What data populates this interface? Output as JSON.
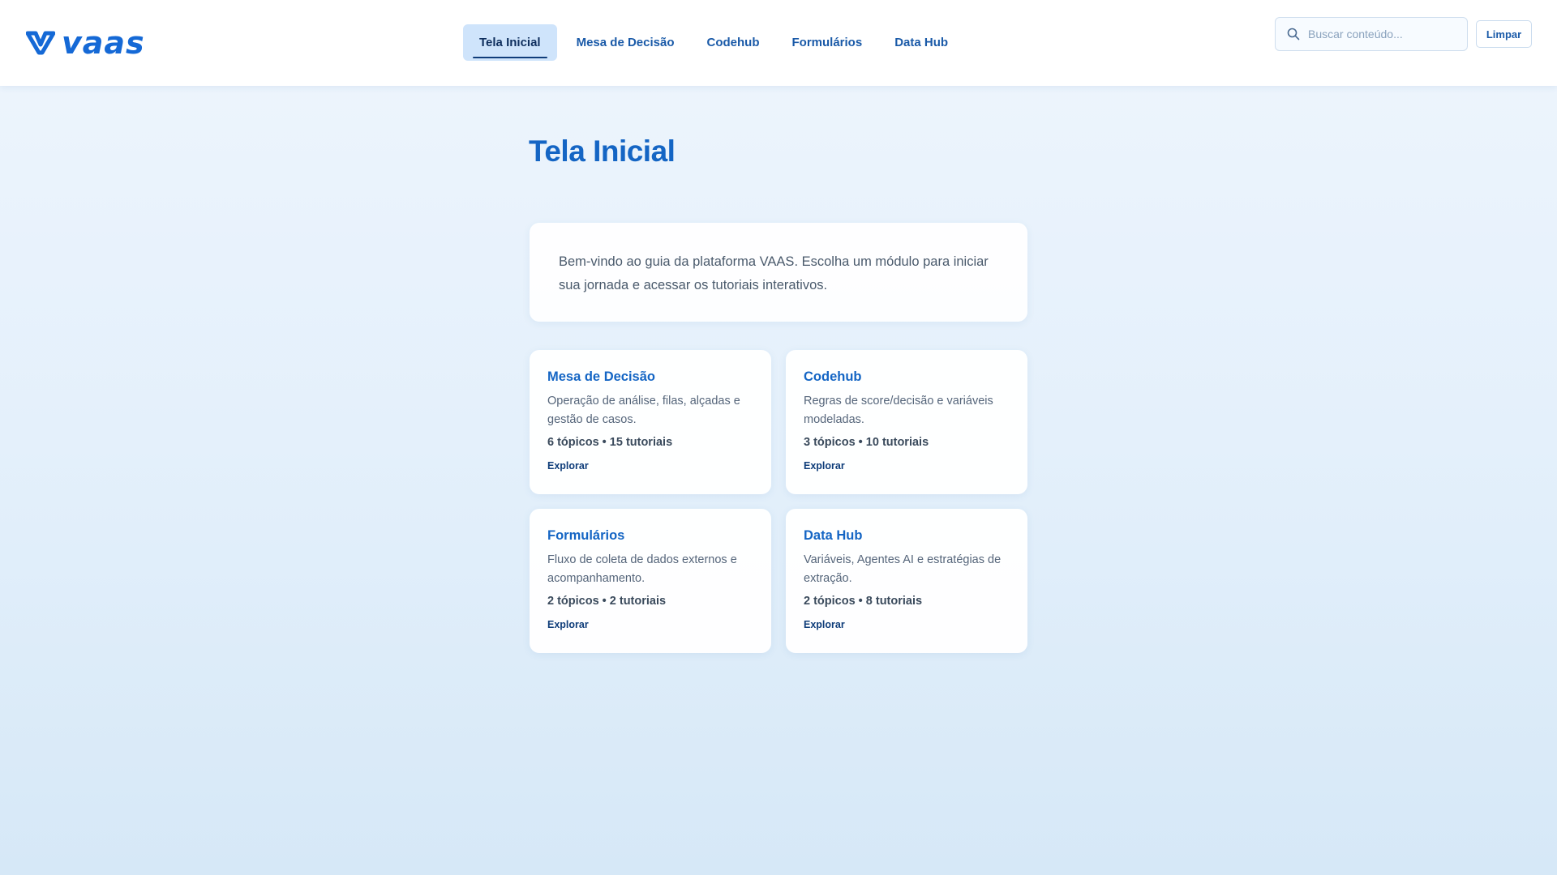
{
  "brand": {
    "name": "VAAS",
    "logo_text": "vaas",
    "accent": "#1569d6"
  },
  "nav": {
    "items": [
      {
        "label": "Tela Inicial",
        "active": true
      },
      {
        "label": "Mesa de Decisão",
        "active": false
      },
      {
        "label": "Codehub",
        "active": false
      },
      {
        "label": "Formulários",
        "active": false
      },
      {
        "label": "Data Hub",
        "active": false
      }
    ]
  },
  "search": {
    "placeholder": "Buscar conteúdo...",
    "value": "",
    "icon": "search-icon"
  },
  "clear_label": "Limpar",
  "page": {
    "title": "Tela Inicial",
    "intro": "Bem-vindo ao guia da plataforma VAAS. Escolha um módulo para iniciar sua jornada e acessar os tutoriais interativos."
  },
  "modules": [
    {
      "title": "Mesa de Decisão",
      "description": "Operação de análise, filas, alçadas e gestão de casos.",
      "stats": "6 tópicos • 15 tutoriais",
      "link": "Explorar"
    },
    {
      "title": "Codehub",
      "description": "Regras de score/decisão e variáveis modeladas.",
      "stats": "3 tópicos • 10 tutoriais",
      "link": "Explorar"
    },
    {
      "title": "Formulários",
      "description": "Fluxo de coleta de dados externos e acompanhamento.",
      "stats": "2 tópicos • 2 tutoriais",
      "link": "Explorar"
    },
    {
      "title": "Data Hub",
      "description": "Variáveis, Agentes AI e estratégias de extração.",
      "stats": "2 tópicos • 8 tutoriais",
      "link": "Explorar"
    }
  ]
}
